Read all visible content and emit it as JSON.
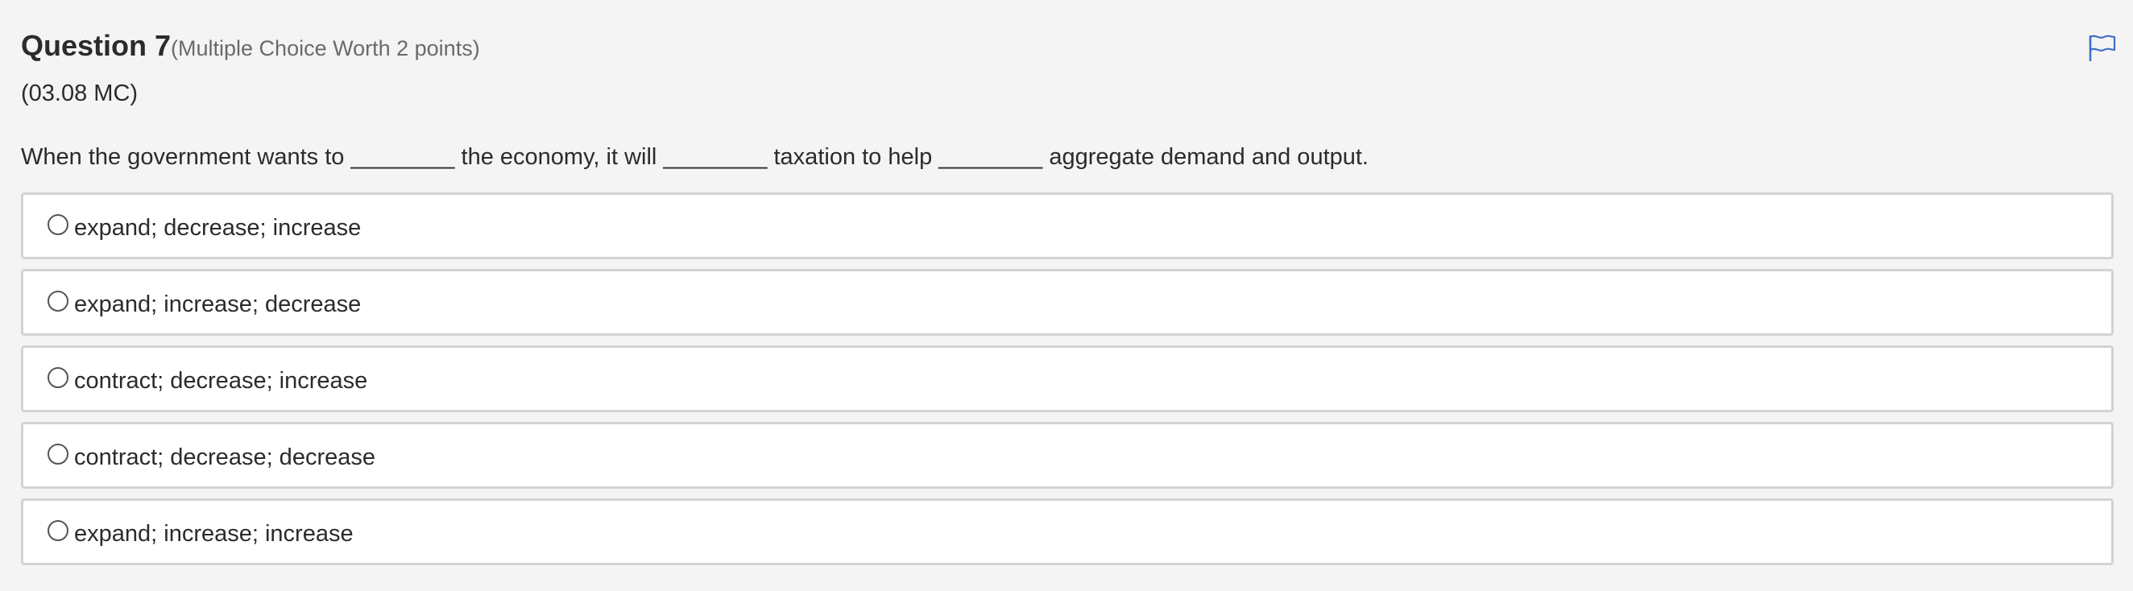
{
  "question": {
    "title": "Question 7",
    "meta": "(Multiple Choice Worth 2 points)",
    "code": "(03.08 MC)",
    "stem": "When the government wants to ________ the economy, it will ________ taxation to help ________ aggregate demand and output."
  },
  "flag": {
    "icon": "flag-icon",
    "color": "#3f6fc6"
  },
  "options": [
    {
      "label": "expand; decrease; increase",
      "selected": false
    },
    {
      "label": "expand; increase; decrease",
      "selected": false
    },
    {
      "label": "contract; decrease; increase",
      "selected": false
    },
    {
      "label": "contract; decrease; decrease",
      "selected": false
    },
    {
      "label": "expand; increase; increase",
      "selected": false
    }
  ]
}
